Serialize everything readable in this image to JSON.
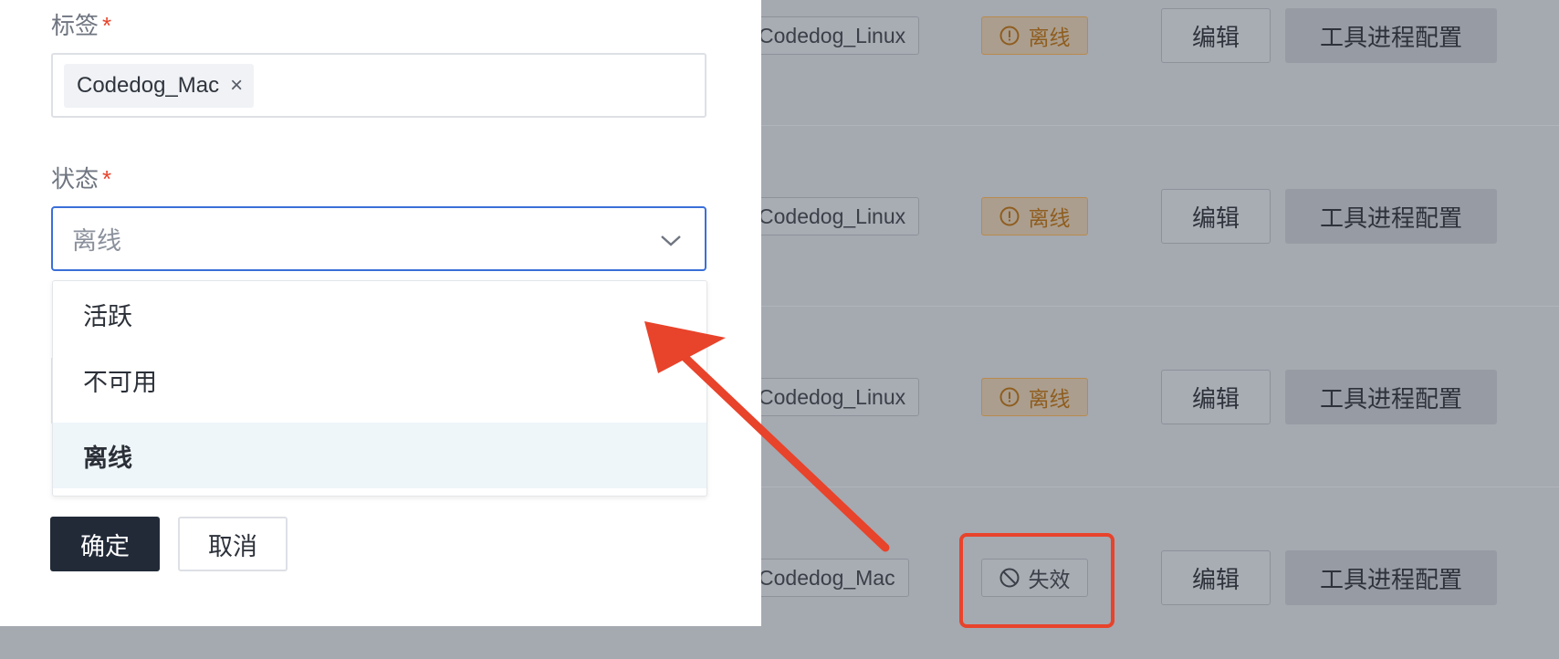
{
  "background_table": {
    "rows": [
      {
        "tag": "Codedog_Linux",
        "status": "离线",
        "status_icon": "warning-circle-icon",
        "edit_label": "编辑",
        "tool_label": "工具进程配置"
      },
      {
        "tag": "Codedog_Linux",
        "status": "离线",
        "status_icon": "warning-circle-icon",
        "edit_label": "编辑",
        "tool_label": "工具进程配置"
      },
      {
        "tag": "Codedog_Linux",
        "status": "离线",
        "status_icon": "warning-circle-icon",
        "edit_label": "编辑",
        "tool_label": "工具进程配置"
      },
      {
        "tag": "Codedog_Mac",
        "status": "失效",
        "status_icon": "prohibited-icon",
        "edit_label": "编辑",
        "tool_label": "工具进程配置"
      }
    ]
  },
  "modal": {
    "tags_label": "标签",
    "required_mark": "*",
    "tags": [
      {
        "label": "Codedog_Mac",
        "remove_glyph": "×"
      }
    ],
    "status_label": "状态",
    "status_value": "离线",
    "status_options": [
      {
        "label": "活跃",
        "selected": false
      },
      {
        "label": "不可用",
        "selected": false
      },
      {
        "label": "离线",
        "selected": true
      }
    ],
    "confirm_label": "确定",
    "cancel_label": "取消"
  },
  "annotations": {
    "arrow_color": "#e8432b",
    "highlight_color": "#e8432b"
  }
}
